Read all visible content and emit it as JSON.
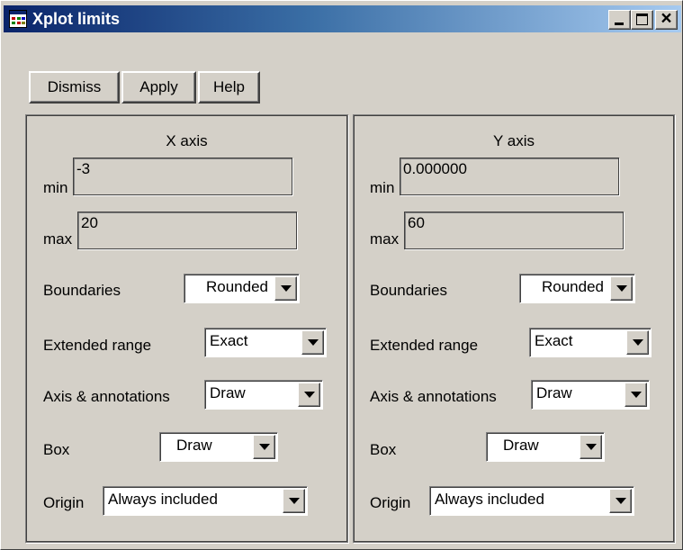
{
  "window": {
    "title": "Xplot limits",
    "controls": {
      "minimize": "_",
      "maximize": "□",
      "close": "✕"
    }
  },
  "toolbar": {
    "dismiss_label": "Dismiss",
    "apply_label": "Apply",
    "help_label": "Help"
  },
  "x_axis": {
    "title": "X axis",
    "min_label": "min",
    "min_value": "-3",
    "max_label": "max",
    "max_value": "20",
    "boundaries_label": "Boundaries",
    "boundaries_value": "Rounded",
    "extended_label": "Extended range",
    "extended_value": "Exact",
    "annotations_label": "Axis & annotations",
    "annotations_value": "Draw",
    "box_label": "Box",
    "box_value": "Draw",
    "origin_label": "Origin",
    "origin_value": "Always included"
  },
  "y_axis": {
    "title": "Y axis",
    "min_label": "min",
    "min_value": "0.000000",
    "max_label": "max",
    "max_value": "60",
    "boundaries_label": "Boundaries",
    "boundaries_value": "Rounded",
    "extended_label": "Extended range",
    "extended_value": "Exact",
    "annotations_label": "Axis & annotations",
    "annotations_value": "Draw",
    "box_label": "Box",
    "box_value": "Draw",
    "origin_label": "Origin",
    "origin_value": "Always included"
  },
  "colors": {
    "titlebar_start": "#0a246a",
    "titlebar_end": "#a6caf0",
    "face": "#d4d0c8"
  }
}
